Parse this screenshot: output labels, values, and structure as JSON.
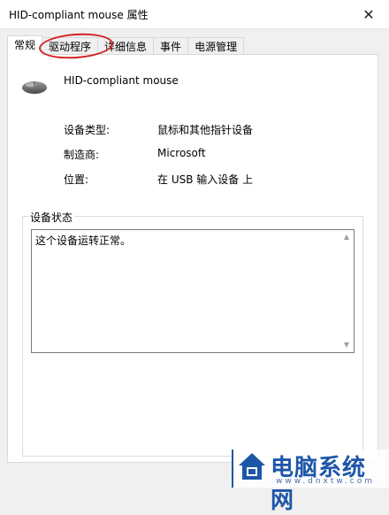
{
  "window": {
    "title": "HID-compliant mouse 属性",
    "close_label": "✕"
  },
  "tabs": [
    {
      "label": "常规",
      "active": true
    },
    {
      "label": "驱动程序",
      "active": false
    },
    {
      "label": "详细信息",
      "active": false
    },
    {
      "label": "事件",
      "active": false
    },
    {
      "label": "电源管理",
      "active": false
    }
  ],
  "device": {
    "name": "HID-compliant mouse",
    "icon": "mouse-icon"
  },
  "properties": [
    {
      "label": "设备类型:",
      "value": "鼠标和其他指针设备"
    },
    {
      "label": "制造商:",
      "value": "Microsoft"
    },
    {
      "label": "位置:",
      "value": "在 USB 输入设备 上"
    }
  ],
  "status": {
    "group_title": "设备状态",
    "text": "这个设备运转正常。"
  },
  "watermark": {
    "text": "电脑系统网",
    "url": "www.dnxtw.com"
  },
  "colors": {
    "annotation": "#d42020",
    "watermark": "#1d56a8"
  }
}
